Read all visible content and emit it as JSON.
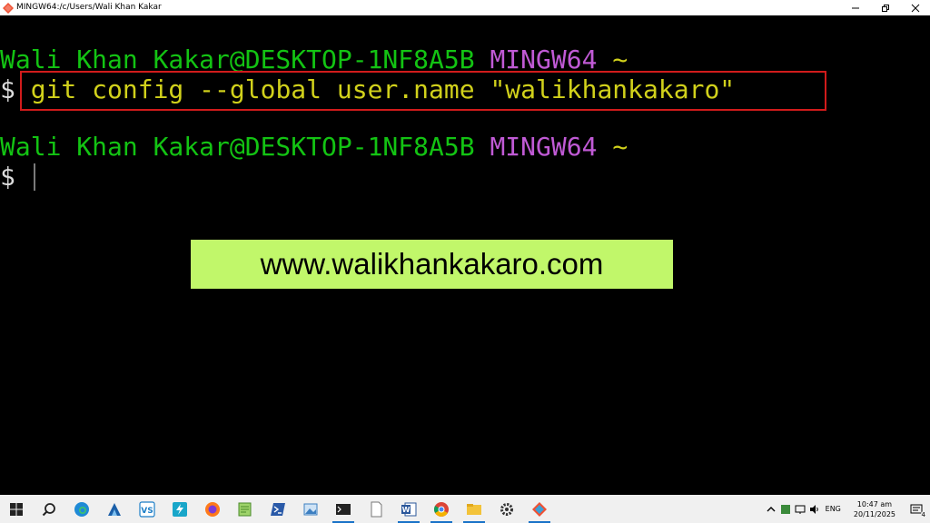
{
  "window": {
    "title": "MINGW64:/c/Users/Wali Khan Kakar"
  },
  "terminal": {
    "prompt_user_host": "Wali Khan Kakar@DESKTOP-1NF8A5B",
    "prompt_env": "MINGW64",
    "prompt_path": "~",
    "prompt_symbol": "$",
    "command": "git config --global user.name \"walikhankakaro\"",
    "colors": {
      "user_host": "#13c313",
      "env": "#c05ad5",
      "path": "#d1d11b",
      "command": "#d1d11b",
      "highlight_border": "#d11b1b"
    }
  },
  "watermark": {
    "text": "www.walikhankakaro.com",
    "background": "#c1f76a"
  },
  "taskbar": {
    "icons": [
      "windows-start-icon",
      "search-icon",
      "edge-icon",
      "sharks-icon",
      "vscode-icon",
      "power-automate-icon",
      "firefox-icon",
      "notepadpp-icon",
      "powershell-icon",
      "photos-icon",
      "terminal-icon",
      "file-icon",
      "word-icon",
      "chrome-icon",
      "file-explorer-icon",
      "settings-icon",
      "git-bash-icon"
    ],
    "tray": {
      "language": "ENG",
      "time": "10:47 am",
      "date": "20/11/2025",
      "notification_count": "4"
    }
  }
}
